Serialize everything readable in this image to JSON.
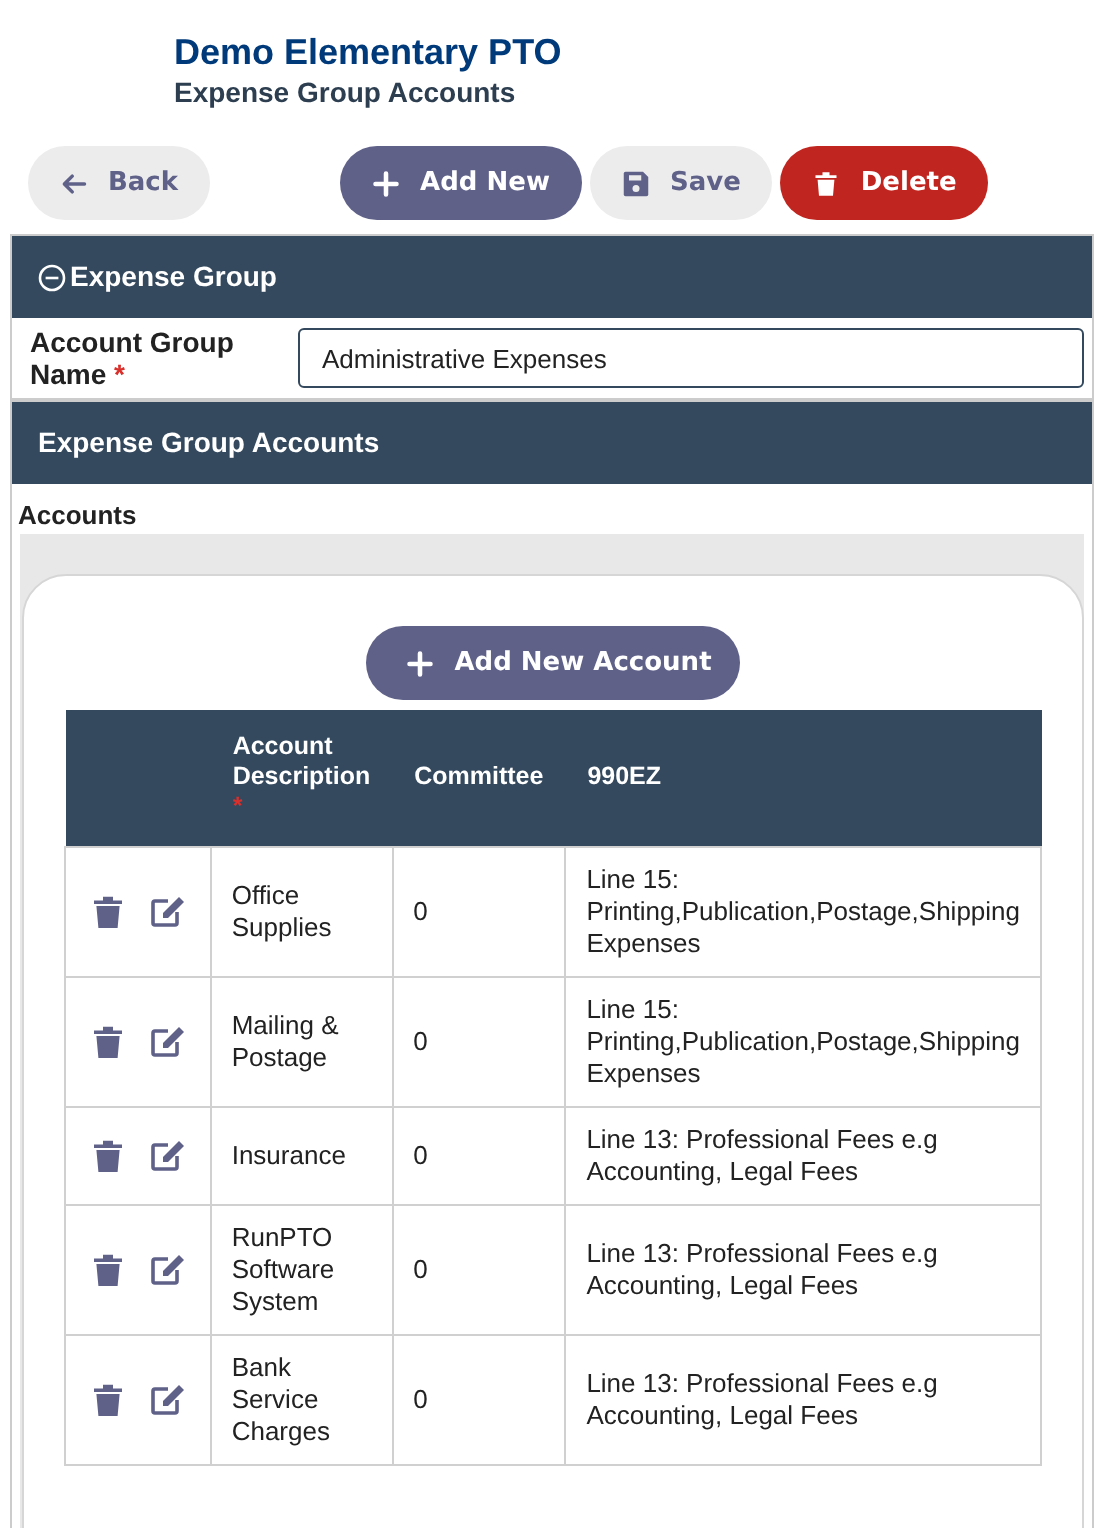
{
  "header": {
    "title": "Demo Elementary PTO",
    "subtitle": "Expense Group Accounts"
  },
  "toolbar": [
    {
      "kind": "back",
      "label": "Back"
    },
    {
      "kind": "add",
      "label": "Add New"
    },
    {
      "kind": "save",
      "label": "Save"
    },
    {
      "kind": "delete",
      "label": "Delete"
    }
  ],
  "expense_group": {
    "title": "Expense Group",
    "expanded": true,
    "field_label": "Account Group Name",
    "required_mark": "*",
    "value": "Administrative Expenses"
  },
  "accounts_section": {
    "title": "Expense Group Accounts",
    "label": "Accounts",
    "add_button": "Add New Account",
    "table": {
      "columns": [
        {
          "label": "Account Description",
          "required_mark": "*"
        },
        {
          "label": "Committee"
        },
        {
          "label": "990EZ"
        }
      ],
      "rows": [
        {
          "description": "Office Supplies",
          "committee": "0",
          "form_990ez": "Line 15: Printing,Publication,Postage,Shipping Expenses"
        },
        {
          "description": "Mailing & Postage",
          "committee": "0",
          "form_990ez": "Line 15: Printing,Publication,Postage,Shipping Expenses"
        },
        {
          "description": "Insurance",
          "committee": "0",
          "form_990ez": "Line 13: Professional Fees e.g Accounting, Legal Fees"
        },
        {
          "description": "RunPTO Software System",
          "committee": "0",
          "form_990ez": "Line 13: Professional Fees e.g Accounting, Legal Fees"
        },
        {
          "description": "Bank Service Charges",
          "committee": "0",
          "form_990ez": "Line 13: Professional Fees e.g Accounting, Legal Fees"
        }
      ]
    }
  }
}
